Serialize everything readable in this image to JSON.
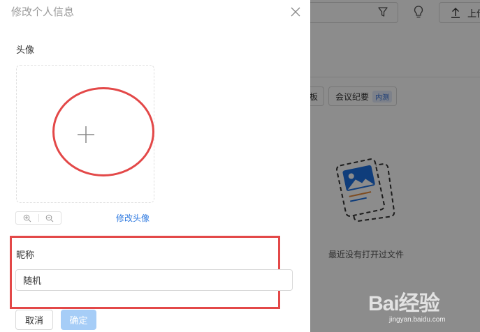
{
  "background": {
    "upload_label": "上传",
    "tag_partial_label": "板",
    "tag_meeting_label": "会议纪要",
    "tag_meeting_badge": "内测",
    "empty_text": "最近没有打开过文件"
  },
  "dialog": {
    "title": "修改个人信息",
    "avatar_label": "头像",
    "edit_avatar_link": "修改头像",
    "nickname_label": "昵称",
    "nickname_value": "随机",
    "cancel_label": "取消",
    "confirm_label": "确定"
  },
  "watermark": {
    "main": "Bai经验",
    "sub": "jingyan.baidu.com"
  },
  "colors": {
    "accent": "#2f7ae0",
    "annotation_red": "#e34848",
    "confirm_disabled": "#a6cdf7"
  }
}
